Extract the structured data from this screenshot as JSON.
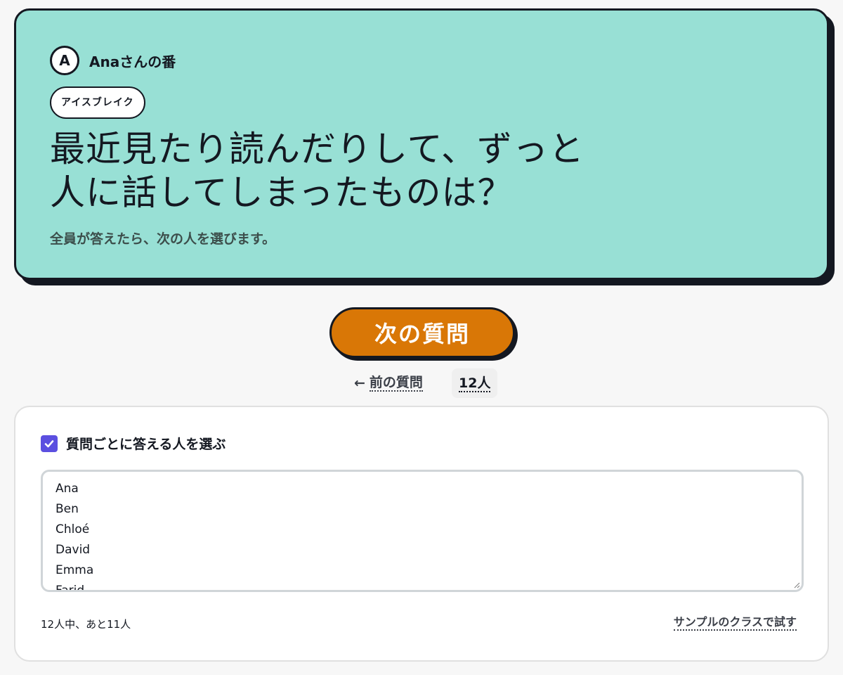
{
  "question_card": {
    "avatar_letter": "A",
    "turn_label": "Anaさんの番",
    "category": "アイスブレイク",
    "question": "最近見たり読んだりして、ずっと人に話してしまったものは？",
    "subtext": "全員が答えたら、次の人を選びます。",
    "bg_color": "#98e0d5"
  },
  "actions": {
    "next_label": "次の質問",
    "prev_arrow": "←",
    "prev_label": "前の質問",
    "count_label": "12人",
    "accent_color": "#d97706"
  },
  "settings": {
    "pick_checkbox_label": "質問ごとに答える人を選ぶ",
    "pick_checked": true,
    "names": [
      "Ana",
      "Ben",
      "Chloé",
      "David",
      "Emma",
      "Farid"
    ],
    "remaining_text": "12人中、あと11人",
    "sample_link": "サンプルのクラスで試す",
    "checkbox_color": "#5b4fe0"
  }
}
